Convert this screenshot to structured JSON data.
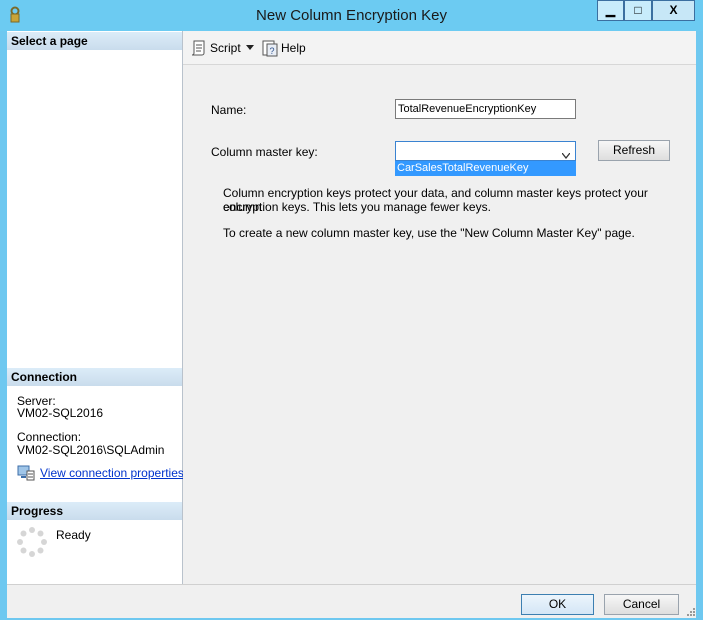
{
  "window": {
    "title": "New Column Encryption Key",
    "minimize_label": "▁",
    "maximize_label": "□",
    "close_label": "X"
  },
  "left": {
    "select_page_header": "Select a page",
    "connection_header": "Connection",
    "server_label": "Server:",
    "server_value": "VM02-SQL2016",
    "connection_label": "Connection:",
    "connection_value": "VM02-SQL2016\\SQLAdmin",
    "view_connection_link": "View connection properties",
    "progress_header": "Progress",
    "progress_status": "Ready"
  },
  "toolbar": {
    "script_label": "Script",
    "help_label": "Help"
  },
  "form": {
    "name_label": "Name:",
    "name_value": "TotalRevenueEncryptionKey",
    "cmk_label": "Column master key:",
    "cmk_selected": "",
    "cmk_dropdown_option": "CarSalesTotalRevenueKey",
    "refresh_label": "Refresh",
    "info_line1": "Column encryption keys protect your data, and column master keys protect your column",
    "info_line2": "encryption keys. This lets you manage fewer keys.",
    "info_line3": "To create a new column master key, use the \"New Column Master Key\" page."
  },
  "buttons": {
    "ok_label": "OK",
    "cancel_label": "Cancel"
  },
  "icons": {
    "window_icon": "key-lock-icon",
    "script_icon": "script-icon",
    "help_icon": "help-icon",
    "connection_icon": "connection-properties-icon",
    "progress_icon": "spinner-icon",
    "dropdown_icon": "chevron-down-icon"
  }
}
